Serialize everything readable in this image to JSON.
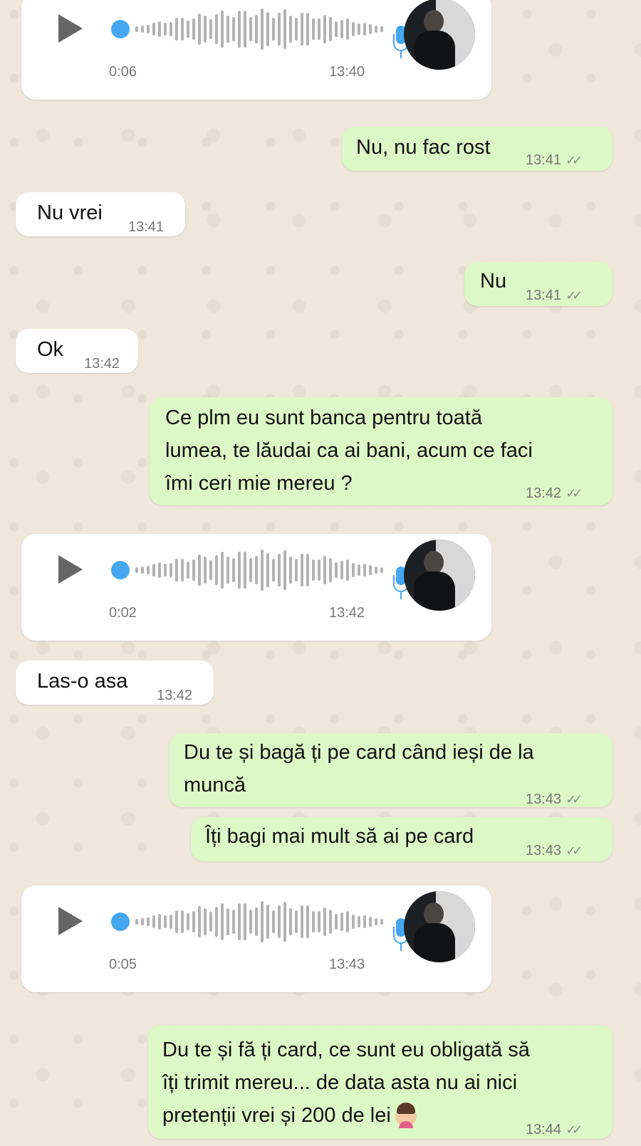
{
  "messages": {
    "voice1": {
      "duration": "0:06",
      "time": "13:40"
    },
    "m1": {
      "text": "Nu, nu fac rost",
      "time": "13:41"
    },
    "m2": {
      "text": "Nu vrei",
      "time": "13:41"
    },
    "m3": {
      "text": "Nu",
      "time": "13:41"
    },
    "m4": {
      "text": "Ok",
      "time": "13:42"
    },
    "m5": {
      "lines": [
        "Ce plm eu sunt banca pentru toată",
        "lumea, te lăudai ca ai bani, acum ce faci",
        "îmi ceri mie mereu ?"
      ],
      "time": "13:42"
    },
    "voice2": {
      "duration": "0:02",
      "time": "13:42"
    },
    "m6": {
      "text": "Las-o asa",
      "time": "13:42"
    },
    "m7": {
      "lines": [
        "Du te și bagă ți pe card când ieși de la",
        "muncă"
      ],
      "time": "13:43"
    },
    "m8": {
      "text": "Îți bagi mai mult să ai pe card",
      "time": "13:43"
    },
    "voice3": {
      "duration": "0:05",
      "time": "13:43"
    },
    "m9": {
      "lines": [
        "Du te și fă ți card, ce sunt eu obligată să",
        "îți trimit mereu... de data asta nu ai nici",
        "pretenții vrei și 200 de lei"
      ],
      "time": "13:44",
      "emoji": "woman-facepalming-emoji"
    }
  },
  "read_receipt_icon": "double-check-icon",
  "colors": {
    "incoming": "#ffffff",
    "outgoing": "#dcf8c6",
    "accent": "#45a7f0",
    "wallpaper": "#efe7dc"
  }
}
